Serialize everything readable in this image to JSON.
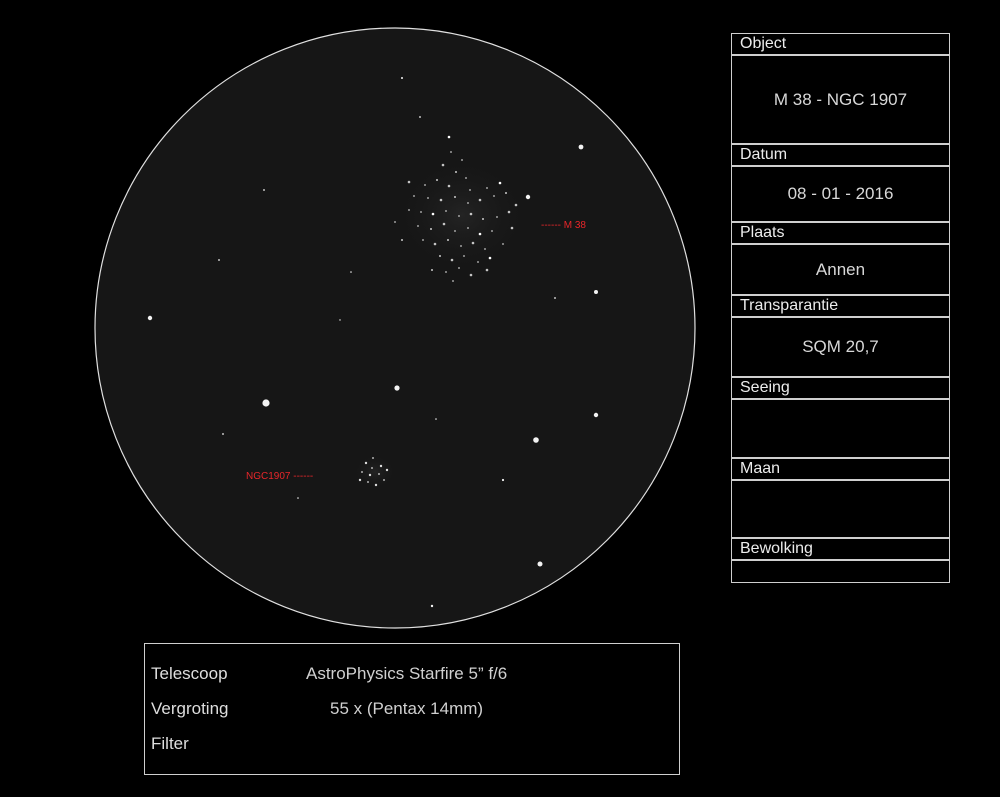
{
  "sketch": {
    "labels": {
      "m38": "------  M 38",
      "ngc1907": "NGC1907 ------"
    },
    "colors": {
      "label": "#e8262a",
      "field": "#161616",
      "rim": "#e0e0e0"
    }
  },
  "info": {
    "object_label": "Object",
    "object_value": "M 38 - NGC 1907",
    "date_label": "Datum",
    "date_value": "08 - 01 - 2016",
    "place_label": "Plaats",
    "place_value": "Annen",
    "transparency_label": "Transparantie",
    "transparency_value": "SQM 20,7",
    "seeing_label": "Seeing",
    "seeing_value": "",
    "moon_label": "Maan",
    "moon_value": "",
    "clouds_label": "Bewolking",
    "clouds_value": ""
  },
  "equipment": {
    "telescope_label": "Telescoop",
    "telescope_value": "AstroPhysics Starfire 5” f/6",
    "magnification_label": "Vergroting",
    "magnification_value": "55 x (Pentax 14mm)",
    "filter_label": "Filter",
    "filter_value": ""
  }
}
